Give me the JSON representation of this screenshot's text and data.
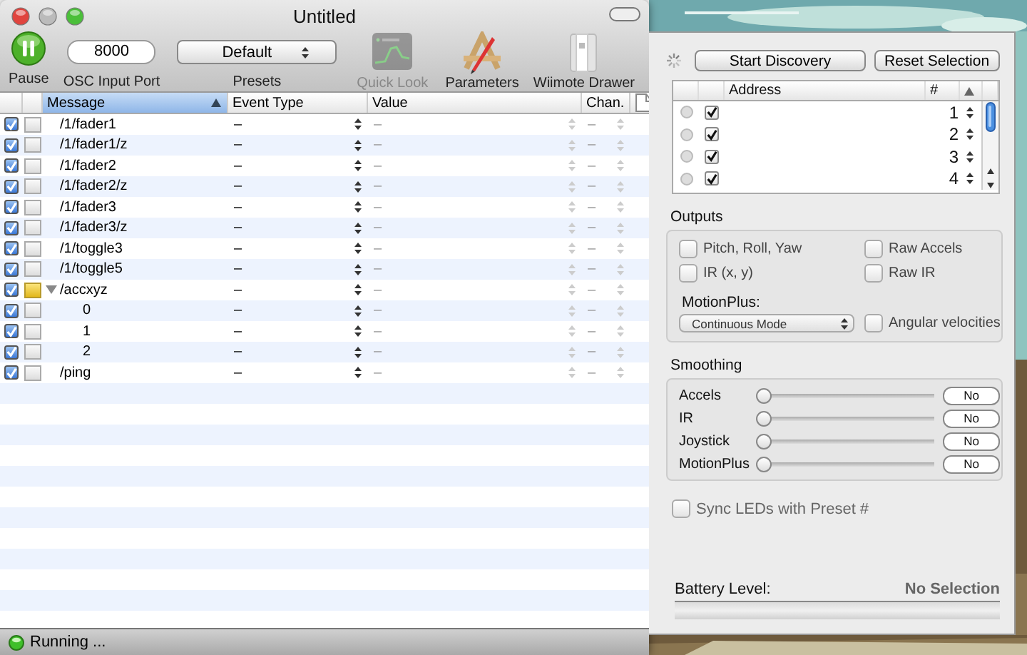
{
  "window": {
    "title": "Untitled"
  },
  "toolbar": {
    "pause": {
      "label": "Pause"
    },
    "port": {
      "value": "8000",
      "label": "OSC Input Port"
    },
    "presets": {
      "value": "Default",
      "label": "Presets"
    },
    "tools": [
      {
        "kind": "quicklook",
        "label": "Quick Look",
        "disabled": true
      },
      {
        "kind": "parameters",
        "label": "Parameters",
        "disabled": false
      },
      {
        "kind": "drawer",
        "label": "Wiimote Drawer",
        "disabled": false
      }
    ]
  },
  "table": {
    "columns": [
      "Message",
      "Event Type",
      "Value",
      "Chan."
    ],
    "rows": [
      {
        "enabled": true,
        "marked": false,
        "message": "/1/fader1",
        "event_type": "–",
        "value": "–",
        "channel": "–"
      },
      {
        "enabled": true,
        "marked": false,
        "message": "/1/fader1/z",
        "event_type": "–",
        "value": "–",
        "channel": "–"
      },
      {
        "enabled": true,
        "marked": false,
        "message": "/1/fader2",
        "event_type": "–",
        "value": "–",
        "channel": "–"
      },
      {
        "enabled": true,
        "marked": false,
        "message": "/1/fader2/z",
        "event_type": "–",
        "value": "–",
        "channel": "–"
      },
      {
        "enabled": true,
        "marked": false,
        "message": "/1/fader3",
        "event_type": "–",
        "value": "–",
        "channel": "–"
      },
      {
        "enabled": true,
        "marked": false,
        "message": "/1/fader3/z",
        "event_type": "–",
        "value": "–",
        "channel": "–"
      },
      {
        "enabled": true,
        "marked": false,
        "message": "/1/toggle3",
        "event_type": "–",
        "value": "–",
        "channel": "–"
      },
      {
        "enabled": true,
        "marked": false,
        "message": "/1/toggle5",
        "event_type": "–",
        "value": "–",
        "channel": "–"
      },
      {
        "enabled": true,
        "marked": true,
        "message": "/accxyz",
        "event_type": "–",
        "value": "–",
        "channel": "–",
        "expanded": true,
        "children": [
          {
            "enabled": true,
            "marked": false,
            "message": "0",
            "event_type": "–",
            "value": "–",
            "channel": "–"
          },
          {
            "enabled": true,
            "marked": false,
            "message": "1",
            "event_type": "–",
            "value": "–",
            "channel": "–"
          },
          {
            "enabled": true,
            "marked": false,
            "message": "2",
            "event_type": "–",
            "value": "–",
            "channel": "–"
          }
        ]
      },
      {
        "enabled": true,
        "marked": false,
        "message": "/ping",
        "event_type": "–",
        "value": "–",
        "channel": "–"
      }
    ]
  },
  "status_bar": {
    "text": "Running ..."
  },
  "drawer": {
    "buttons": [
      "Start Discovery",
      "Reset Selection"
    ],
    "devices": {
      "columns": [
        "Address",
        "#"
      ],
      "rows": [
        {
          "checked": true,
          "number": "1"
        },
        {
          "checked": true,
          "number": "2"
        },
        {
          "checked": true,
          "number": "3"
        },
        {
          "checked": true,
          "number": "4"
        }
      ]
    },
    "outputs": {
      "title": "Outputs",
      "options": [
        {
          "label": "Pitch, Roll, Yaw",
          "checked": false
        },
        {
          "label": "Raw Accels",
          "checked": false
        },
        {
          "label": "IR (x, y)",
          "checked": false
        },
        {
          "label": "Raw IR",
          "checked": false
        }
      ],
      "motionplus_label": "MotionPlus:",
      "motionplus_mode": "Continuous Mode",
      "angular": {
        "label": "Angular velocities",
        "checked": false
      }
    },
    "smoothing": {
      "title": "Smoothing",
      "sliders": [
        {
          "name": "Accels",
          "level": 0,
          "reading": "No"
        },
        {
          "name": "IR",
          "level": 0,
          "reading": "No"
        },
        {
          "name": "Joystick",
          "level": 0,
          "reading": "No"
        },
        {
          "name": "MotionPlus",
          "level": 0,
          "reading": "No"
        }
      ]
    },
    "sync": {
      "label": "Sync LEDs with Preset #",
      "checked": false
    },
    "battery": {
      "label": "Battery Level:",
      "value": "No Selection"
    }
  }
}
